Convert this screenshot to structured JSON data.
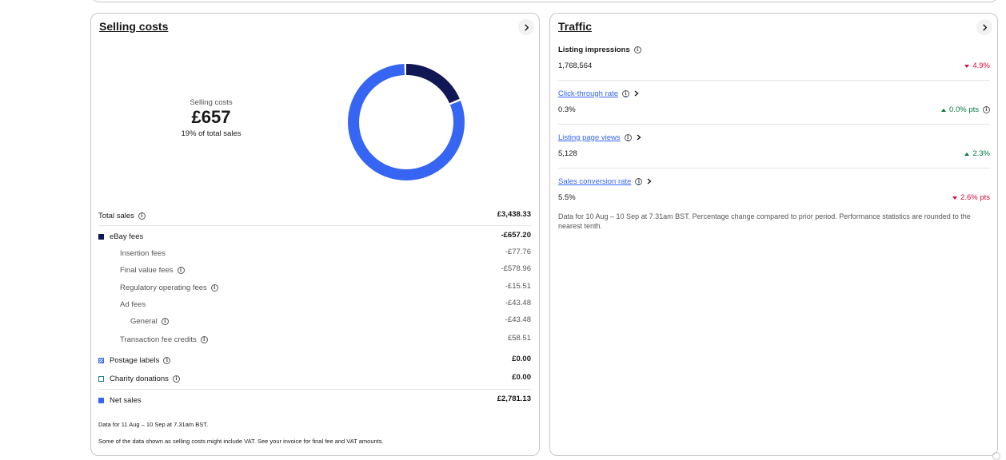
{
  "selling_costs": {
    "title": "Selling costs",
    "summary_label": "Selling costs",
    "summary_amount": "£657",
    "summary_pct": "19% of total sales",
    "donut": {
      "segments": [
        {
          "name": "eBay fees",
          "fraction": 0.19,
          "color": "#111655"
        },
        {
          "name": "Net sales",
          "fraction": 0.81,
          "color": "#3665f3"
        }
      ]
    },
    "total_sales": {
      "label": "Total sales",
      "value": "£3,438.33"
    },
    "ebay_fees": {
      "label": "eBay fees",
      "value": "-£657.20",
      "color": "#111655"
    },
    "insertion_fees": {
      "label": "Insertion fees",
      "value": "-£77.76"
    },
    "final_value_fees": {
      "label": "Final value fees",
      "value": "-£578.96"
    },
    "regulatory_fees": {
      "label": "Regulatory operating fees",
      "value": "-£15.51"
    },
    "ad_fees": {
      "label": "Ad fees",
      "value": "-£43.48"
    },
    "general": {
      "label": "General",
      "value": "-£43.48"
    },
    "transaction_credits": {
      "label": "Transaction fee credits",
      "value": "£58.51"
    },
    "postage_labels": {
      "label": "Postage labels",
      "value": "£0.00"
    },
    "charity": {
      "label": "Charity donations",
      "value": "£0.00"
    },
    "net_sales": {
      "label": "Net sales",
      "value": "£2,781.13",
      "color": "#3665f3"
    },
    "footnote1": "Data for 11 Aug – 10 Sep at 7.31am BST.",
    "footnote2": "Some of the data shown as selling costs might include VAT. See your invoice for final fee and VAT amounts."
  },
  "traffic": {
    "title": "Traffic",
    "impressions": {
      "label": "Listing impressions",
      "value": "1,768,564",
      "change": "4.9%",
      "direction": "down"
    },
    "ctr": {
      "label": "Click-through rate",
      "value": "0.3%",
      "change": "0.0% pts",
      "direction": "up"
    },
    "page_views": {
      "label": "Listing page views",
      "value": "5,128",
      "change": "2.3%",
      "direction": "up"
    },
    "conversion": {
      "label": "Sales conversion rate",
      "value": "5.5%",
      "change": "2.6% pts",
      "direction": "down"
    },
    "note": "Data for 10 Aug – 10 Sep at 7.31am BST. Percentage change compared to prior period. Performance statistics are rounded to the nearest tenth."
  },
  "icons": {
    "info": "info-icon",
    "chevron": "chevron-right-icon"
  }
}
